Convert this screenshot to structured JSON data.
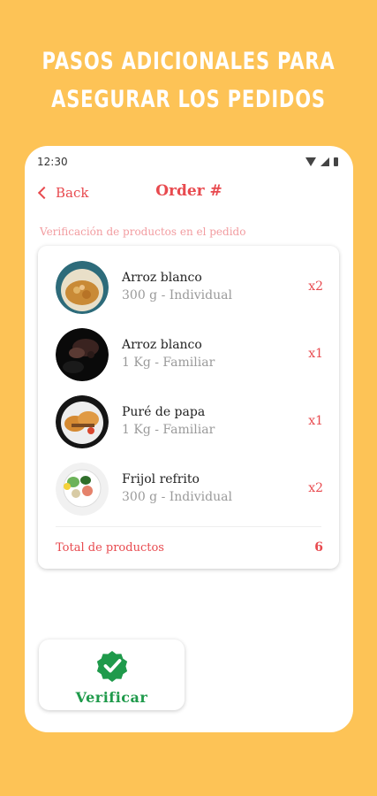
{
  "headline": {
    "line1": "PASOS ADICIONALES PARA",
    "line2": "ASEGURAR LOS PEDIDOS"
  },
  "status_bar": {
    "time": "12:30",
    "icons": [
      "wifi-icon",
      "signal-icon",
      "battery-icon"
    ]
  },
  "header": {
    "back_label": "Back",
    "title": "Order #"
  },
  "section_title": "Verificación de productos en el pedido",
  "products": [
    {
      "name": "Arroz blanco",
      "detail": "300 g - Individual",
      "qty": "x2",
      "image": "rice-bowl"
    },
    {
      "name": "Arroz blanco",
      "detail": "1 Kg - Familiar",
      "qty": "x1",
      "image": "dark-dish"
    },
    {
      "name": "Puré de papa",
      "detail": "1 Kg - Familiar",
      "qty": "x1",
      "image": "burger-plate"
    },
    {
      "name": "Frijol refrito",
      "detail": "300 g - Individual",
      "qty": "x2",
      "image": "salad-bowl"
    }
  ],
  "total": {
    "label": "Total de productos",
    "value": "6"
  },
  "verify_button": {
    "label": "Verificar",
    "icon": "check-badge-icon"
  },
  "colors": {
    "background": "#FDC356",
    "accent": "#E84A4F",
    "success": "#1F9A4B"
  }
}
